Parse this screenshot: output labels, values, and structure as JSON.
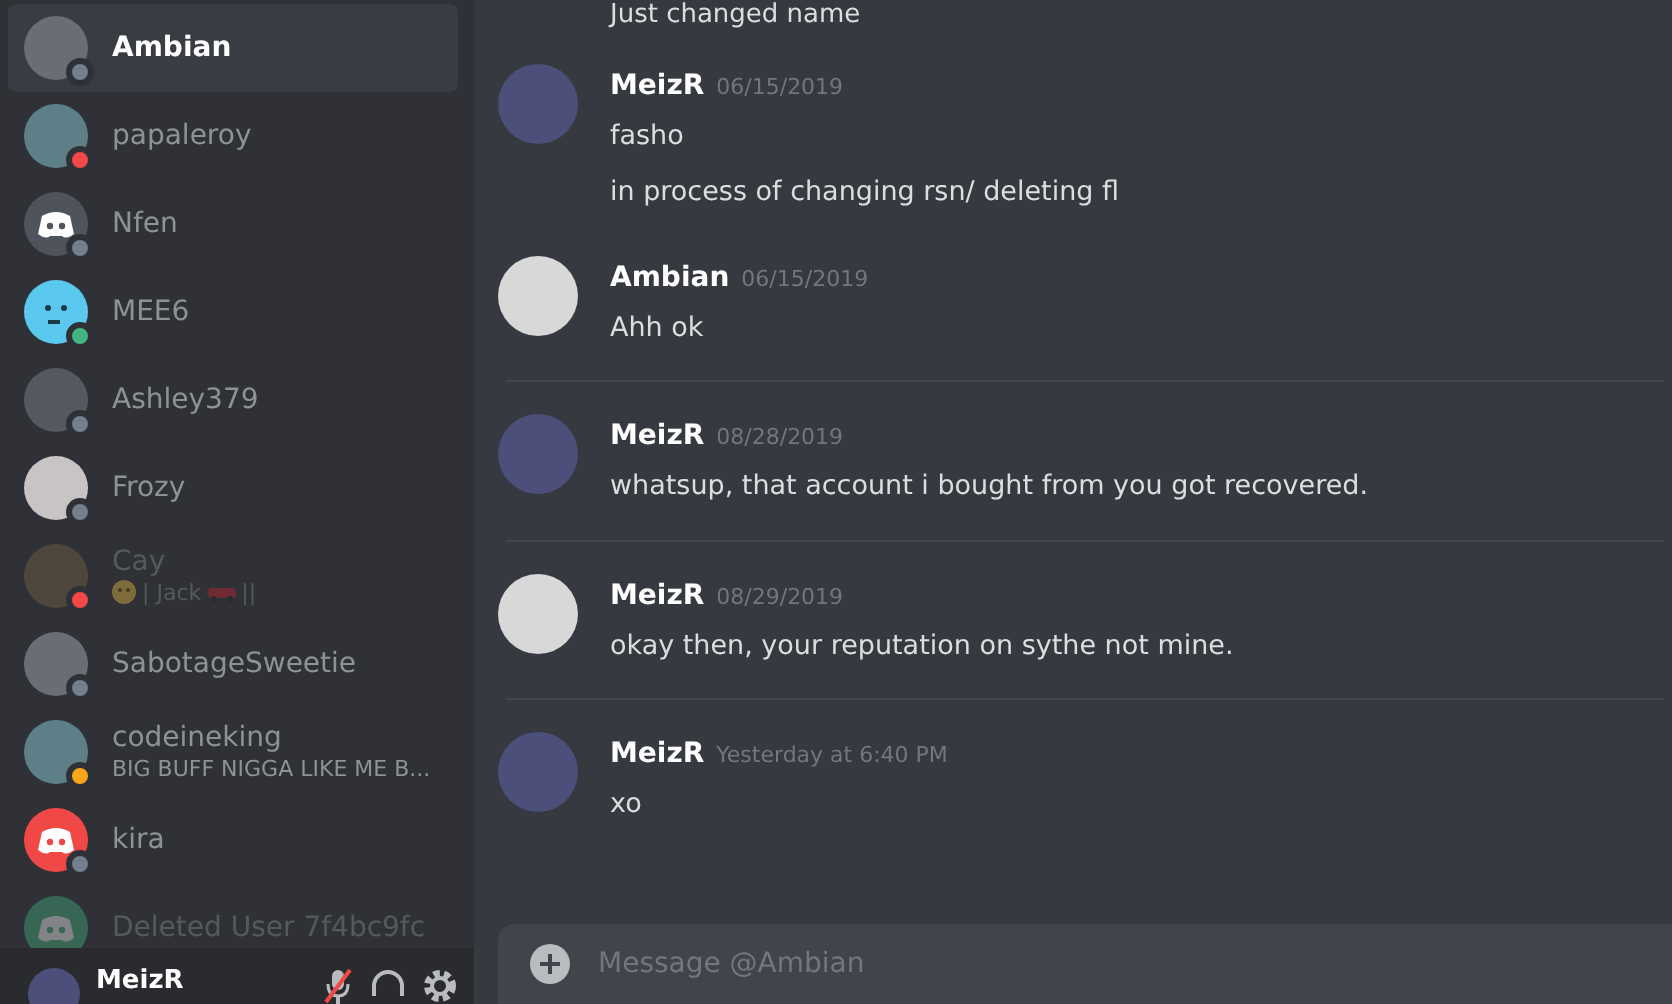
{
  "direct_messages": [
    {
      "name": "Ambian",
      "selected": true,
      "faded": false,
      "color": "#747f8d",
      "kind": "photo"
    },
    {
      "name": "papaleroy",
      "selected": false,
      "faded": false,
      "color": "#f04747",
      "kind": "photo"
    },
    {
      "name": "Nfen",
      "selected": false,
      "faded": false,
      "color": "#747f8d",
      "kind": "logo"
    },
    {
      "name": "MEE6",
      "selected": false,
      "faded": false,
      "color": "#43b581",
      "kind": "robot"
    },
    {
      "name": "Ashley379",
      "selected": false,
      "faded": false,
      "color": "#747f8d",
      "kind": "photo"
    },
    {
      "name": "Frozy",
      "selected": false,
      "faded": false,
      "color": "#747f8d",
      "kind": "photo"
    },
    {
      "name": "Cay",
      "selected": false,
      "faded": true,
      "color": "#f04747",
      "kind": "photo",
      "activity": "| Jack",
      "activity_end": "||"
    },
    {
      "name": "SabotageSweetie",
      "selected": false,
      "faded": false,
      "color": "#747f8d",
      "kind": "photo"
    },
    {
      "name": "codeineking",
      "selected": false,
      "faded": false,
      "color": "#faa61a",
      "kind": "photo",
      "activity": "BIG BUFF NIGGA LIKE ME B..."
    },
    {
      "name": "kira",
      "selected": false,
      "faded": false,
      "color": "#747f8d",
      "kind": "logo"
    },
    {
      "name": "Deleted User 7f4bc9fc",
      "selected": false,
      "faded": true,
      "kind": "logo"
    }
  ],
  "user_panel": {
    "username": "MeizR",
    "muted": true
  },
  "messages": {
    "partial_line": "Just changed name",
    "groups": [
      {
        "author": "MeizR",
        "timestamp": "06/15/2019",
        "divider_before": false,
        "lines": [
          "fasho",
          "in process of changing rsn/ deleting fl"
        ]
      },
      {
        "author": "Ambian",
        "timestamp": "06/15/2019",
        "divider_before": false,
        "lines": [
          "Ahh ok"
        ]
      },
      {
        "author": "MeizR",
        "timestamp": "08/28/2019",
        "divider_before": true,
        "lines": [
          "whatsup, that account i bought from you got recovered."
        ]
      },
      {
        "author": "MeizR",
        "timestamp": "08/29/2019",
        "divider_before": true,
        "lines": [
          "okay then, your reputation on sythe not mine."
        ]
      },
      {
        "author": "MeizR",
        "timestamp": "Yesterday at 6:40 PM",
        "divider_before": true,
        "lines": [
          "xo"
        ]
      }
    ]
  },
  "composer": {
    "placeholder": "Message @Ambian"
  }
}
